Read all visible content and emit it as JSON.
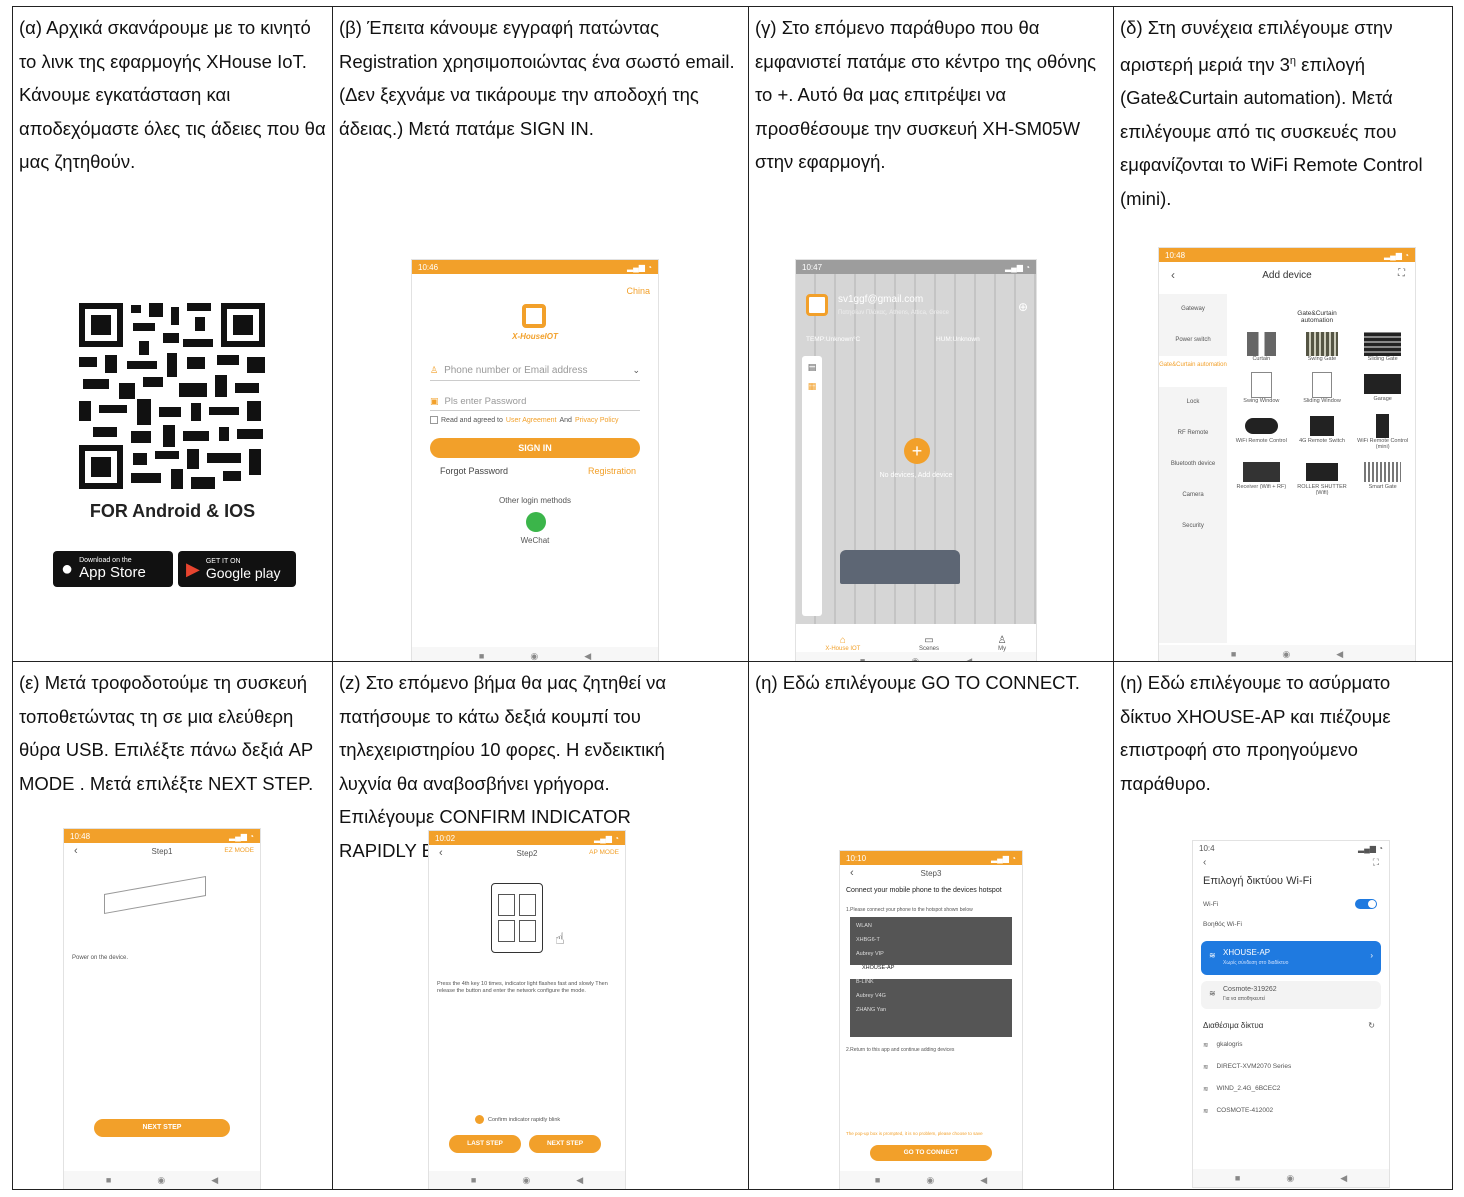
{
  "cells": [
    {
      "caption": "(α) Αρχικά σκανάρουμε με το κινητό το λινκ της εφαρμογής XHouse IoT. Κάνουμε εγκατάσταση και αποδεχόμαστε όλες τις άδειες που θα μας ζητηθούν."
    },
    {
      "caption": "(β) Έπειτα κάνουμε εγγραφή πατώντας Registration χρησιμοποιώντας ένα σωστό email. (Δεν ξεχνάμε να τικάρουμε την αποδοχή της άδειας.) Μετά πατάμε SIGN IN."
    },
    {
      "caption": "(γ) Στο επόμενο παράθυρο που θα εμφανιστεί πατάμε στο κέντρο της οθόνης το +. Αυτό θα μας επιτρέψει να προσθέσουμε την συσκευή XH-SM05W στην εφαρμογή."
    },
    {
      "caption_pre": "(δ) Στη συνέχεια επιλέγουμε στην αριστερή μεριά την 3",
      "caption_sup": "η",
      "caption_post": " επιλογή (Gate&Curtain automation). Μετά επιλέγουμε από τις συσκευές που εμφανίζονται το WiFi Remote Control (mini)."
    },
    {
      "caption": "(ε) Μετά τροφοδοτούμε τη συσκευή τοποθετώντας τη σε μια ελεύθερη θύρα USB. Επιλέξτε πάνω δεξιά AP MODE . Μετά επιλέξτε NEXT STEP."
    },
    {
      "caption": "(z) Στο επόμενο βήμα θα μας ζητηθεί να πατήσουμε το κάτω δεξιά κουμπί του τηλεχειριστηρίου 10 φορες. Η ενδεικτική λυχνία θα αναβοσβήνει γρήγορα. Επιλέγουμε CONFIRM INDICATOR RAPIDLY BLINK και NEXT STEP."
    },
    {
      "caption": "(η) Εδώ επιλέγουμε GO TO CONNECT."
    },
    {
      "caption": "(η) Εδώ επιλέγουμε το ασύρματο δίκτυο XHOUSE-AP και πιέζουμε επιστροφή στο προηγούμενο παράθυρο."
    }
  ],
  "qr": {
    "platforms": "FOR Android & IOS",
    "appstore_small": "Download on the",
    "appstore": "App Store",
    "gplay_small": "GET IT ON",
    "gplay": "Google play"
  },
  "login": {
    "time": "10:46",
    "region": "China",
    "logo": "X-HouseIOT",
    "email_placeholder": "Phone number or Email address",
    "password_placeholder": "Pls enter Password",
    "agree_pre": "Read and agreed to ",
    "agree_link1": "User Agreement",
    "agree_and": "And",
    "agree_link2": "Privacy Policy",
    "signin": "SIGN IN",
    "forgot": "Forgot Password",
    "register": "Registration",
    "other": "Other login methods",
    "wechat": "WeChat"
  },
  "home": {
    "time": "10:47",
    "email": "sv1ggf@gmail.com",
    "location": "Πατησίων Πλάκας, Athens, Attica, Greece",
    "temp": "TEMP:Unknown°C",
    "hum": "HUM:Unknown",
    "empty": "No devices, Add device",
    "tabs": [
      "X-House IOT",
      "Scenes",
      "My"
    ]
  },
  "adddev": {
    "time": "10:48",
    "title": "Add device",
    "side": [
      "Gateway",
      "Power switch",
      "Gate&Curtain automation",
      "Lock",
      "RF Remote",
      "Bluetooth device",
      "Camera",
      "Security"
    ],
    "group": "Gate&Curtain automation",
    "devices": [
      "Curtain",
      "Swing Gate",
      "Sliding Gate",
      "Swing Window",
      "Sliding Window",
      "Garage",
      "WiFi Remote Control",
      "4G Remote Switch",
      "WiFi Remote Control (mini)",
      "Receiver (Wifi + RF)",
      "ROLLER SHUTTER (Wifi)",
      "Smart Gate"
    ]
  },
  "step1": {
    "time": "10:48",
    "title": "Step1",
    "mode": "EZ MODE",
    "instr": "Power on the device.",
    "next": "NEXT STEP"
  },
  "step2": {
    "time": "10:02",
    "title": "Step2",
    "mode": "AP MODE",
    "instr": "Press the 4th key 10 times, indicator light flashes fast and slowly Then release the button and enter the network configure the mode.",
    "confirm": "Confirm indicator rapidly blink",
    "last": "LAST STEP",
    "next": "NEXT STEP"
  },
  "step3": {
    "time": "10:10",
    "title": "Step3",
    "head": "Connect your mobile phone to the devices hotspot",
    "sub": "1.Please connect your phone to the hotspot shown below",
    "nets": [
      "WLAN",
      "XHBG6-T",
      "Aubrey VIP",
      "XHOUSE-AP",
      "B-LINK",
      "Aubrey V4G",
      "ZHANG Yan"
    ],
    "back": "2.Return to this app and continue adding devices",
    "warn": "The pop-up box is prompted, it is no problem, please choose to save",
    "go": "GO TO CONNECT"
  },
  "wifi": {
    "time": "10:4",
    "title": "Επιλογή δικτύου Wi-Fi",
    "wifi_label": "Wi-Fi",
    "helper": "Βοηθός Wi-Fi",
    "selected": "XHOUSE-AP",
    "selected_sub": "Χωρίς σύνδεση στο διαδίκτυο",
    "second": "Cosmote-319262",
    "second_sub": "Για να αποθηκευτεί",
    "avail": "Διαθέσιμα δίκτυα",
    "nets": [
      "gkalogris",
      "DIRECT-XVM2070 Series",
      "WIND_2.4G_6BCEC2",
      "COSMOTE-412002"
    ]
  }
}
